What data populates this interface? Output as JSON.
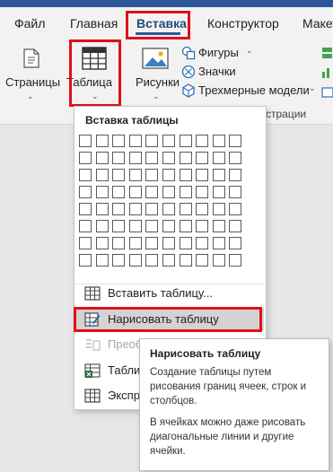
{
  "ribbon_tabs": [
    "Файл",
    "Главная",
    "Вставка",
    "Конструктор",
    "Макет"
  ],
  "ribbon": {
    "pages_label": "Страницы",
    "table_label": "Таблица",
    "pictures_label": "Рисунки",
    "shapes_label": "Фигуры",
    "icons_label": "Значки",
    "models_label": "Трехмерные модели",
    "group_caption": "страции"
  },
  "dropdown": {
    "title": "Вставка таблицы",
    "grid_rows": 8,
    "grid_cols": 10,
    "items": [
      {
        "label": "Вставить таблицу...",
        "icon": "insert-table-icon"
      },
      {
        "label": "Нарисовать таблицу",
        "icon": "draw-table-icon"
      },
      {
        "label": "Преоб",
        "icon": "convert-text-icon"
      },
      {
        "label": "Табли",
        "icon": "excel-table-icon"
      },
      {
        "label": "Экспр",
        "icon": "quick-tables-icon"
      }
    ]
  },
  "tooltip": {
    "title": "Нарисовать таблицу",
    "p1": "Создание таблицы путем рисования границ ячеек, строк и столбцов.",
    "p2": "В ячейках можно даже рисовать диагональные линии и другие ячейки."
  },
  "colors": {
    "accent": "#2b579a",
    "highlight": "#e0101a"
  }
}
